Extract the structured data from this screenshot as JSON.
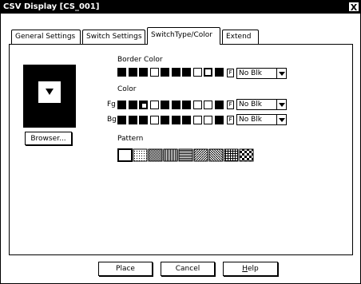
{
  "window": {
    "title": "CSV Display [CS_001]",
    "close_glyph": "X"
  },
  "tabs": [
    {
      "label": "General Settings"
    },
    {
      "label": "Switch Settings"
    },
    {
      "label": "SwitchType/Color"
    },
    {
      "label": "Extend"
    }
  ],
  "active_tab": "SwitchType/Color",
  "preview": {
    "browse_label": "Browser..."
  },
  "border_color": {
    "label": "Border Color",
    "blink_value": "No Blk",
    "swatches": [
      "filled",
      "filled",
      "filled",
      "empty",
      "filled",
      "filled",
      "filled",
      "empty",
      "selected-empty",
      "filled"
    ]
  },
  "color": {
    "label": "Color",
    "fg": {
      "label": "Fg",
      "blink_value": "No Blk",
      "swatches": [
        "filled",
        "filled",
        "selected-dot",
        "empty",
        "filled",
        "filled",
        "filled",
        "empty",
        "empty",
        "filled"
      ]
    },
    "bg": {
      "label": "Bg",
      "blink_value": "No Blk",
      "swatches": [
        "filled",
        "filled",
        "filled",
        "empty",
        "filled",
        "filled",
        "filled",
        "empty",
        "empty",
        "filled"
      ]
    }
  },
  "pattern": {
    "label": "Pattern",
    "count": 9
  },
  "footer": {
    "place_label": "Place",
    "cancel_label": "Cancel",
    "help_label": "Help"
  },
  "colors": {
    "foreground": "#000000",
    "background": "#ffffff"
  }
}
